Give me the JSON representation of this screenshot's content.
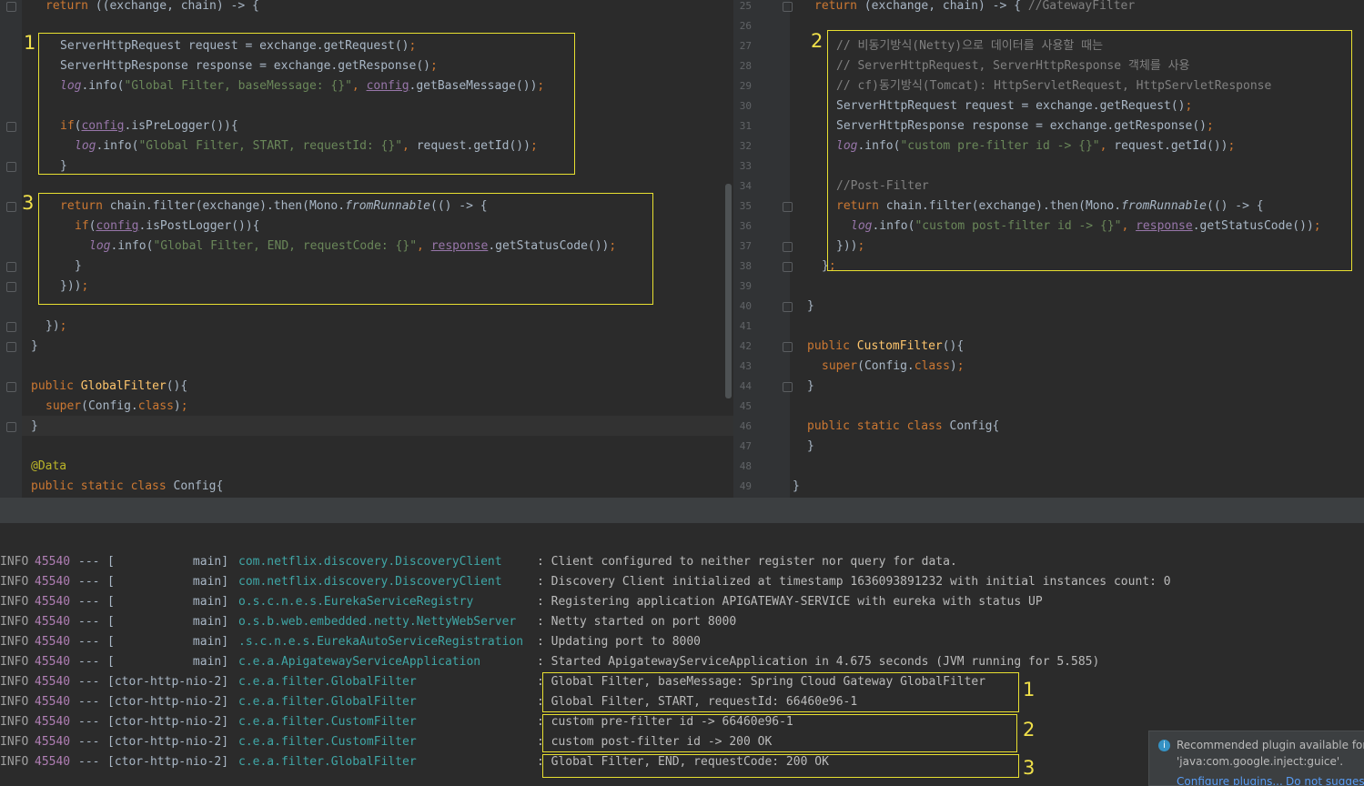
{
  "left_editor": {
    "lines": [
      [
        [
          "kw",
          "return "
        ],
        [
          "",
          "((exchange, chain) -> {"
        ]
      ],
      [],
      [
        [
          "",
          "ServerHttpRequest request = exchange.getRequest()"
        ],
        [
          "kw",
          ";"
        ]
      ],
      [
        [
          "",
          "ServerHttpResponse response = exchange.getResponse()"
        ],
        [
          "kw",
          ";"
        ]
      ],
      [
        [
          "log",
          "log"
        ],
        [
          "",
          ".info("
        ],
        [
          "str",
          "\"Global Filter, baseMessage: {}\""
        ],
        [
          "kw",
          ", "
        ],
        [
          "fld",
          "config"
        ],
        [
          "",
          ".getBaseMessage())"
        ],
        [
          "kw",
          ";"
        ]
      ],
      [],
      [
        [
          "kw",
          "if"
        ],
        [
          "",
          "("
        ],
        [
          "fld",
          "config"
        ],
        [
          "",
          ".isPreLogger()){"
        ]
      ],
      [
        [
          "log",
          "log"
        ],
        [
          "",
          ".info("
        ],
        [
          "str",
          "\"Global Filter, START, requestId: {}\""
        ],
        [
          "kw",
          ", "
        ],
        [
          "",
          "request.getId())"
        ],
        [
          "kw",
          ";"
        ]
      ],
      [
        [
          "",
          "}"
        ]
      ],
      [],
      [
        [
          "kw",
          "return "
        ],
        [
          "",
          "chain.filter(exchange).then(Mono."
        ],
        [
          "it",
          "fromRunnable"
        ],
        [
          "",
          "(() -> {"
        ]
      ],
      [
        [
          "kw",
          "if"
        ],
        [
          "",
          "("
        ],
        [
          "fld",
          "config"
        ],
        [
          "",
          ".isPostLogger()){"
        ]
      ],
      [
        [
          "log",
          "log"
        ],
        [
          "",
          ".info("
        ],
        [
          "str",
          "\"Global Filter, END, requestCode: {}\""
        ],
        [
          "kw",
          ", "
        ],
        [
          "fld",
          "response"
        ],
        [
          "",
          ".getStatusCode())"
        ],
        [
          "kw",
          ";"
        ]
      ],
      [
        [
          "",
          "}"
        ]
      ],
      [
        [
          "",
          "}))"
        ],
        [
          "kw",
          ";"
        ]
      ],
      [],
      [
        [
          "",
          "})"
        ],
        [
          "kw",
          ";"
        ]
      ],
      [
        [
          "",
          "}"
        ]
      ],
      [],
      [
        [
          "kw",
          "public "
        ],
        [
          "fn",
          "GlobalFilter"
        ],
        [
          "",
          "(){"
        ]
      ],
      [
        [
          "kw",
          "super"
        ],
        [
          "",
          "(Config."
        ],
        [
          "kw",
          "class"
        ],
        [
          "",
          ")"
        ],
        [
          "kw",
          ";"
        ]
      ],
      [
        [
          "",
          "}"
        ]
      ],
      [],
      [
        [
          "ann",
          "@Data"
        ]
      ],
      [
        [
          "kw",
          "public static class "
        ],
        [
          "",
          "Config{"
        ]
      ]
    ]
  },
  "right_editor": {
    "line_numbers": [
      "25",
      "26",
      "27",
      "28",
      "29",
      "30",
      "31",
      "32",
      "33",
      "34",
      "35",
      "36",
      "37",
      "38",
      "39",
      "40",
      "41",
      "42",
      "43",
      "44",
      "45",
      "46",
      "47",
      "48",
      "49"
    ],
    "lines": [
      [
        [
          "kw",
          "return "
        ],
        [
          "",
          "(exchange, chain) -> { "
        ],
        [
          "cm",
          "//GatewayFilter"
        ]
      ],
      [],
      [
        [
          "cm",
          "// 비동기방식(Netty)으로 데이터를 사용할 때는"
        ]
      ],
      [
        [
          "cm",
          "// ServerHttpRequest, ServerHttpResponse 객체를 사용"
        ]
      ],
      [
        [
          "cm",
          "// cf)동기방식(Tomcat): HttpServletRequest, HttpServletResponse"
        ]
      ],
      [
        [
          "",
          "ServerHttpRequest request = exchange.getRequest()"
        ],
        [
          "kw",
          ";"
        ]
      ],
      [
        [
          "",
          "ServerHttpResponse response = exchange.getResponse()"
        ],
        [
          "kw",
          ";"
        ]
      ],
      [
        [
          "log",
          "log"
        ],
        [
          "",
          ".info("
        ],
        [
          "str",
          "\"custom pre-filter id -> {}\""
        ],
        [
          "kw",
          ", "
        ],
        [
          "",
          "request.getId())"
        ],
        [
          "kw",
          ";"
        ]
      ],
      [],
      [
        [
          "cm",
          "//Post-Filter"
        ]
      ],
      [
        [
          "kw",
          "return "
        ],
        [
          "",
          "chain.filter(exchange).then(Mono."
        ],
        [
          "it",
          "fromRunnable"
        ],
        [
          "",
          "(() -> {"
        ]
      ],
      [
        [
          "log",
          "log"
        ],
        [
          "",
          ".info("
        ],
        [
          "str",
          "\"custom post-filter id -> {}\""
        ],
        [
          "kw",
          ", "
        ],
        [
          "fld",
          "response"
        ],
        [
          "",
          ".getStatusCode())"
        ],
        [
          "kw",
          ";"
        ]
      ],
      [
        [
          "",
          "}))"
        ],
        [
          "kw",
          ";"
        ]
      ],
      [
        [
          "",
          "}"
        ],
        [
          "kw",
          ";"
        ]
      ],
      [],
      [
        [
          "",
          "}"
        ]
      ],
      [],
      [
        [
          "kw",
          "public "
        ],
        [
          "fn",
          "CustomFilter"
        ],
        [
          "",
          "(){"
        ]
      ],
      [
        [
          "kw",
          "super"
        ],
        [
          "",
          "(Config."
        ],
        [
          "kw",
          "class"
        ],
        [
          "",
          ")"
        ],
        [
          "kw",
          ";"
        ]
      ],
      [
        [
          "",
          "}"
        ]
      ],
      [],
      [
        [
          "kw",
          "public static class "
        ],
        [
          "",
          "Config{"
        ]
      ],
      [
        [
          "",
          "}"
        ]
      ],
      [],
      [
        [
          "",
          "}"
        ]
      ]
    ]
  },
  "console": {
    "rows": [
      {
        "level": "INFO",
        "pid": "45540",
        "sep": "---",
        "thread": "[           main]",
        "logger": "com.netflix.discovery.DiscoveryClient",
        "msg": ": Client configured to neither register nor query for data."
      },
      {
        "level": "INFO",
        "pid": "45540",
        "sep": "---",
        "thread": "[           main]",
        "logger": "com.netflix.discovery.DiscoveryClient",
        "msg": ": Discovery Client initialized at timestamp 1636093891232 with initial instances count: 0"
      },
      {
        "level": "INFO",
        "pid": "45540",
        "sep": "---",
        "thread": "[           main]",
        "logger": "o.s.c.n.e.s.EurekaServiceRegistry",
        "msg": ": Registering application APIGATEWAY-SERVICE with eureka with status UP"
      },
      {
        "level": "INFO",
        "pid": "45540",
        "sep": "---",
        "thread": "[           main]",
        "logger": "o.s.b.web.embedded.netty.NettyWebServer",
        "msg": ": Netty started on port 8000"
      },
      {
        "level": "INFO",
        "pid": "45540",
        "sep": "---",
        "thread": "[           main]",
        "logger": ".s.c.n.e.s.EurekaAutoServiceRegistration",
        "msg": ": Updating port to 8000"
      },
      {
        "level": "INFO",
        "pid": "45540",
        "sep": "---",
        "thread": "[           main]",
        "logger": "c.e.a.ApigatewayServiceApplication",
        "msg": ": Started ApigatewayServiceApplication in 4.675 seconds (JVM running for 5.585)"
      },
      {
        "level": "INFO",
        "pid": "45540",
        "sep": "---",
        "thread": "[ctor-http-nio-2]",
        "logger": "c.e.a.filter.GlobalFilter",
        "msg": ": Global Filter, baseMessage: Spring Cloud Gateway GlobalFilter"
      },
      {
        "level": "INFO",
        "pid": "45540",
        "sep": "---",
        "thread": "[ctor-http-nio-2]",
        "logger": "c.e.a.filter.GlobalFilter",
        "msg": ": Global Filter, START, requestId: 66460e96-1"
      },
      {
        "level": "INFO",
        "pid": "45540",
        "sep": "---",
        "thread": "[ctor-http-nio-2]",
        "logger": "c.e.a.filter.CustomFilter",
        "msg": ": custom pre-filter id -> 66460e96-1"
      },
      {
        "level": "INFO",
        "pid": "45540",
        "sep": "---",
        "thread": "[ctor-http-nio-2]",
        "logger": "c.e.a.filter.CustomFilter",
        "msg": ": custom post-filter id -> 200 OK"
      },
      {
        "level": "INFO",
        "pid": "45540",
        "sep": "---",
        "thread": "[ctor-http-nio-2]",
        "logger": "c.e.a.filter.GlobalFilter",
        "msg": ": Global Filter, END, requestCode: 200 OK"
      }
    ]
  },
  "annotations": {
    "left_box_1": "1",
    "left_box_3": "3",
    "right_box_2": "2",
    "console_box_1": "1",
    "console_box_2": "2",
    "console_box_3": "3"
  },
  "notification": {
    "icon": "info-icon",
    "text_line1": "Recommended plugin available for de",
    "text_line2": "'java:com.google.inject:guice'.",
    "link_configure": "Configure plugins...",
    "link_dont_suggest": "Do not suggest"
  }
}
